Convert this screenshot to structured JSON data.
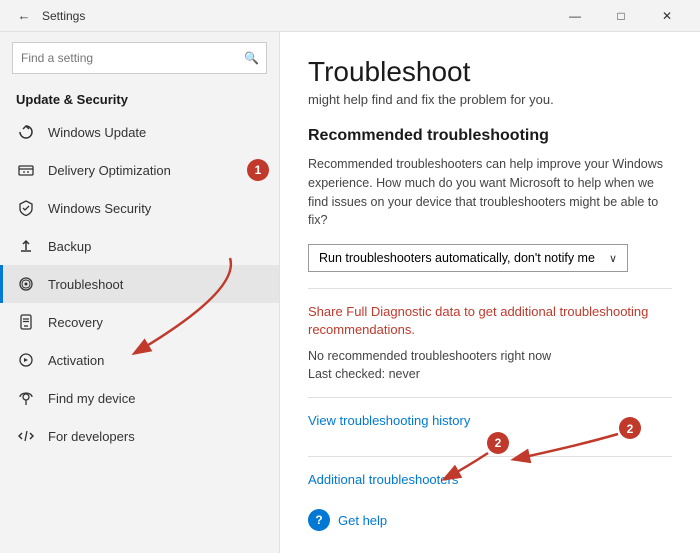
{
  "titlebar": {
    "back_label": "←",
    "title": "Settings",
    "minimize": "—",
    "maximize": "□",
    "close": "✕"
  },
  "sidebar": {
    "search_placeholder": "Find a setting",
    "search_icon": "🔍",
    "section_title": "Update & Security",
    "nav_items": [
      {
        "id": "windows-update",
        "label": "Windows Update",
        "icon": "↻",
        "active": false
      },
      {
        "id": "delivery-optimization",
        "label": "Delivery Optimization",
        "icon": "📥",
        "active": false,
        "annotation": "1"
      },
      {
        "id": "windows-security",
        "label": "Windows Security",
        "icon": "🛡",
        "active": false
      },
      {
        "id": "backup",
        "label": "Backup",
        "icon": "↑",
        "active": false
      },
      {
        "id": "troubleshoot",
        "label": "Troubleshoot",
        "icon": "🔑",
        "active": true
      },
      {
        "id": "recovery",
        "label": "Recovery",
        "icon": "📱",
        "active": false
      },
      {
        "id": "activation",
        "label": "Activation",
        "icon": "⚙",
        "active": false
      },
      {
        "id": "find-my-device",
        "label": "Find my device",
        "icon": "📍",
        "active": false
      },
      {
        "id": "for-developers",
        "label": "For developers",
        "icon": "💻",
        "active": false
      }
    ]
  },
  "main": {
    "page_title": "Troubleshoot",
    "page_subtitle": "might help find and fix the problem for you.",
    "section_heading": "Recommended troubleshooting",
    "section_description": "Recommended troubleshooters can help improve your Windows experience. How much do you want Microsoft to help when we find issues on your device that troubleshooters might be able to fix?",
    "dropdown_value": "Run troubleshooters automatically, don't notify me",
    "diagnostic_link": "Share Full Diagnostic data to get additional troubleshooting recommendations.",
    "no_troubleshooters": "No recommended troubleshooters right now",
    "last_checked": "Last checked: never",
    "view_history_link": "View troubleshooting history",
    "additional_link": "Additional troubleshooters",
    "get_help_label": "Get help",
    "annotation_2": "2"
  }
}
